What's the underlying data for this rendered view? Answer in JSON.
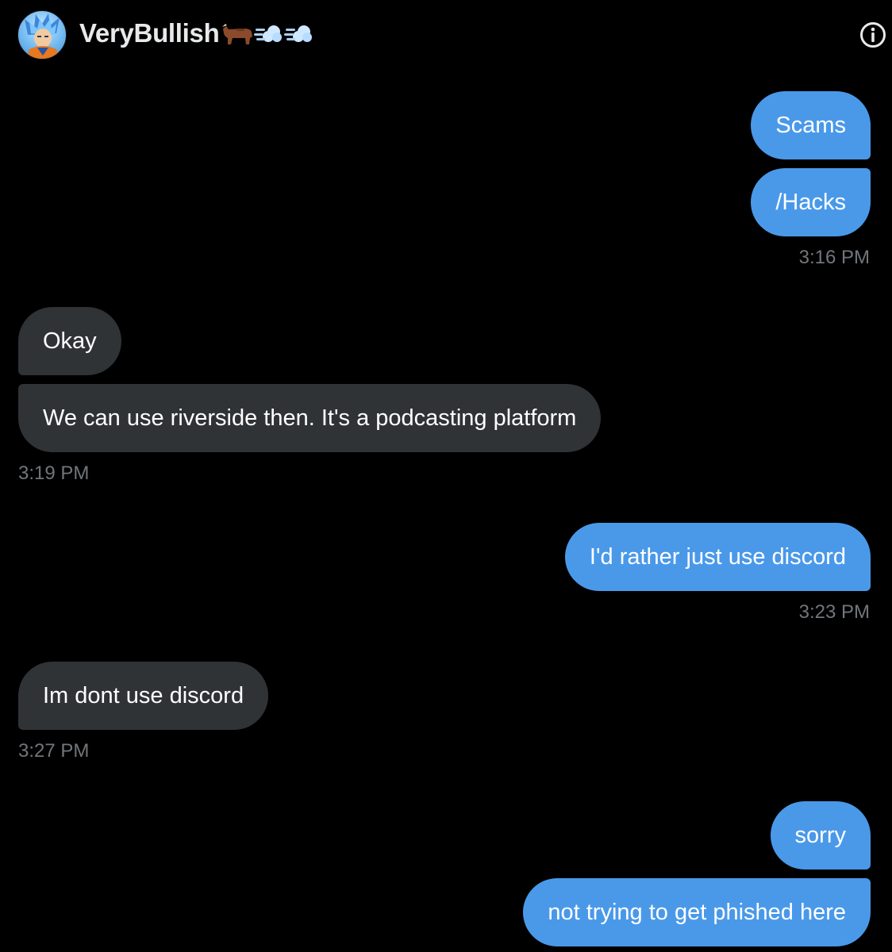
{
  "header": {
    "user_name": "VeryBullish",
    "name_emojis": [
      "ox-emoji",
      "dash-emoji",
      "dash-emoji"
    ],
    "avatar_icon": "goku-avatar",
    "info_icon": "info-icon"
  },
  "messages": [
    {
      "id": "m1",
      "side": "sent",
      "text": "Scams"
    },
    {
      "id": "m2",
      "side": "sent",
      "text": "/Hacks"
    },
    {
      "id": "t1",
      "timestamp": "3:16 PM"
    },
    {
      "id": "m3",
      "side": "received",
      "text": "Okay"
    },
    {
      "id": "m4",
      "side": "received",
      "text": "We can use riverside then. It's a podcasting platform"
    },
    {
      "id": "t2",
      "timestamp": "3:19 PM"
    },
    {
      "id": "m5",
      "side": "sent",
      "text": "I'd rather just use discord"
    },
    {
      "id": "t3",
      "timestamp": "3:23 PM"
    },
    {
      "id": "m6",
      "side": "received",
      "text": "Im dont use discord"
    },
    {
      "id": "t4",
      "timestamp": "3:27 PM"
    },
    {
      "id": "m7",
      "side": "sent",
      "text": "sorry"
    },
    {
      "id": "m8",
      "side": "sent",
      "text": "not trying to get phished here"
    }
  ],
  "colors": {
    "background": "#000000",
    "sent_bubble": "#4a99e9",
    "received_bubble": "#2f3336",
    "timestamp": "#71767b"
  }
}
